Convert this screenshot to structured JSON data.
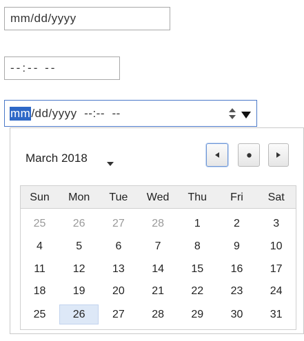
{
  "date_input": {
    "placeholder_text": "mm/dd/yyyy"
  },
  "time_input": {
    "placeholder_text": "--:-- --"
  },
  "datetime_input": {
    "month_segment": "mm",
    "rest_text": "/dd/yyyy  --:--  --",
    "spin_icon": "spin-up-down-icon",
    "dropdown_icon": "triangle-down-icon"
  },
  "calendar": {
    "month_label": "March 2018",
    "nav": {
      "prev": "◂",
      "today": "●",
      "next": "▸"
    },
    "weekdays": [
      "Sun",
      "Mon",
      "Tue",
      "Wed",
      "Thu",
      "Fri",
      "Sat"
    ],
    "weeks": [
      [
        "25",
        "26",
        "27",
        "28",
        "1",
        "2",
        "3"
      ],
      [
        "4",
        "5",
        "6",
        "7",
        "8",
        "9",
        "10"
      ],
      [
        "11",
        "12",
        "13",
        "14",
        "15",
        "16",
        "17"
      ],
      [
        "18",
        "19",
        "20",
        "21",
        "22",
        "23",
        "24"
      ],
      [
        "25",
        "26",
        "27",
        "28",
        "29",
        "30",
        "31"
      ]
    ],
    "other_month_cells_first_row": 4,
    "selected_day": "26",
    "accent_color": "#2e68c7",
    "selected_bg": "#dde8f7"
  }
}
